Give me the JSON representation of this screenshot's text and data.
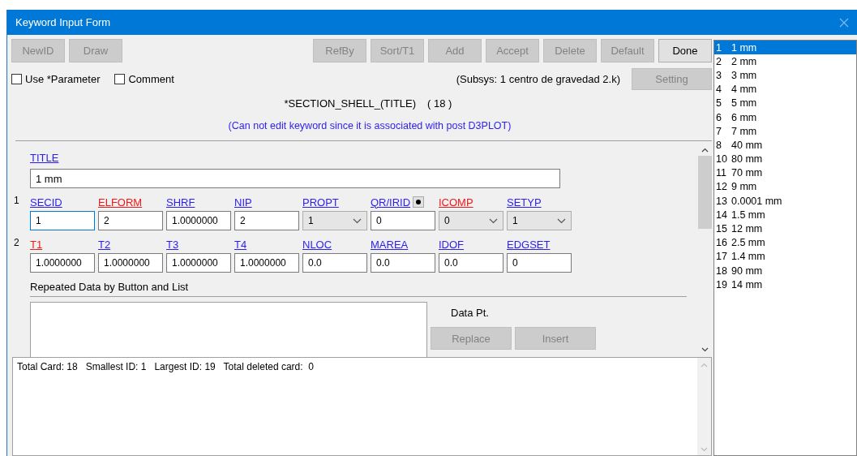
{
  "window": {
    "title": "Keyword Input Form"
  },
  "toolbar": {
    "left": [
      {
        "label": "NewID",
        "disabled": true
      },
      {
        "label": "Draw",
        "disabled": true
      }
    ],
    "right": [
      {
        "label": "RefBy",
        "disabled": true
      },
      {
        "label": "Sort/T1",
        "disabled": true
      },
      {
        "label": "Add",
        "disabled": true
      },
      {
        "label": "Accept",
        "disabled": true
      },
      {
        "label": "Delete",
        "disabled": true
      },
      {
        "label": "Default",
        "disabled": true
      },
      {
        "label": "Done",
        "disabled": false
      }
    ]
  },
  "options": [
    {
      "label": "Use *Parameter",
      "checked": false
    },
    {
      "label": "Comment",
      "checked": false
    }
  ],
  "subsys": "(Subsys: 1 centro de gravedad 2.k)",
  "setting_button": {
    "label": "Setting",
    "disabled": true
  },
  "keyword": {
    "name": "*SECTION_SHELL_(TITLE)",
    "count": "( 18 )"
  },
  "notice": "(Can not edit keyword since it is associated with post D3PLOT)",
  "title_field": {
    "label": "TITLE",
    "value": "1 mm"
  },
  "cards": [
    {
      "number": "1",
      "fields": [
        {
          "label": "SECID",
          "required": false,
          "kind": "input",
          "value": "1",
          "focused": true
        },
        {
          "label": "ELFORM",
          "required": true,
          "kind": "input",
          "value": "2",
          "focused": false
        },
        {
          "label": "SHRF",
          "required": false,
          "kind": "input",
          "value": "1.0000000",
          "focused": false
        },
        {
          "label": "NIP",
          "required": false,
          "kind": "input",
          "value": "2",
          "focused": false
        },
        {
          "label": "PROPT",
          "required": false,
          "kind": "select",
          "value": "1",
          "focused": false
        },
        {
          "label": "QR/IRID",
          "required": false,
          "kind": "input",
          "value": "0",
          "focused": false,
          "picker": true
        },
        {
          "label": "ICOMP",
          "required": true,
          "kind": "select",
          "value": "0",
          "focused": false
        },
        {
          "label": "SETYP",
          "required": false,
          "kind": "select",
          "value": "1",
          "focused": false
        }
      ]
    },
    {
      "number": "2",
      "fields": [
        {
          "label": "T1",
          "required": true,
          "kind": "input",
          "value": "1.0000000",
          "focused": false
        },
        {
          "label": "T2",
          "required": false,
          "kind": "input",
          "value": "1.0000000",
          "focused": false
        },
        {
          "label": "T3",
          "required": false,
          "kind": "input",
          "value": "1.0000000",
          "focused": false
        },
        {
          "label": "T4",
          "required": false,
          "kind": "input",
          "value": "1.0000000",
          "focused": false
        },
        {
          "label": "NLOC",
          "required": false,
          "kind": "input",
          "value": "0.0",
          "focused": false
        },
        {
          "label": "MAREA",
          "required": false,
          "kind": "input",
          "value": "0.0",
          "focused": false
        },
        {
          "label": "IDOF",
          "required": false,
          "kind": "input",
          "value": "0.0",
          "focused": false
        },
        {
          "label": "EDGSET",
          "required": false,
          "kind": "input",
          "value": "0",
          "focused": false
        }
      ]
    }
  ],
  "repeated": {
    "title": "Repeated Data by Button and List",
    "data_label": "Data Pt.",
    "buttons": [
      {
        "label": "Replace",
        "disabled": true
      },
      {
        "label": "Insert",
        "disabled": true
      }
    ]
  },
  "status": "Total Card: 18   Smallest ID: 1   Largest ID: 19   Total deleted card:  0",
  "id_list": [
    {
      "id": "1",
      "title": "1 mm",
      "selected": true
    },
    {
      "id": "2",
      "title": "2 mm",
      "selected": false
    },
    {
      "id": "3",
      "title": "3 mm",
      "selected": false
    },
    {
      "id": "4",
      "title": "4 mm",
      "selected": false
    },
    {
      "id": "5",
      "title": "5 mm",
      "selected": false
    },
    {
      "id": "6",
      "title": "6 mm",
      "selected": false
    },
    {
      "id": "7",
      "title": "7 mm",
      "selected": false
    },
    {
      "id": "8",
      "title": "40 mm",
      "selected": false
    },
    {
      "id": "10",
      "title": "80 mm",
      "selected": false
    },
    {
      "id": "11",
      "title": "70 mm",
      "selected": false
    },
    {
      "id": "12",
      "title": "9 mm",
      "selected": false
    },
    {
      "id": "13",
      "title": "0.0001 mm",
      "selected": false
    },
    {
      "id": "14",
      "title": "1.5 mm",
      "selected": false
    },
    {
      "id": "15",
      "title": "12 mm",
      "selected": false
    },
    {
      "id": "16",
      "title": "2.5 mm",
      "selected": false
    },
    {
      "id": "17",
      "title": "1.4 mm",
      "selected": false
    },
    {
      "id": "18",
      "title": "90 mm",
      "selected": false
    },
    {
      "id": "19",
      "title": "14 mm",
      "selected": false
    }
  ]
}
